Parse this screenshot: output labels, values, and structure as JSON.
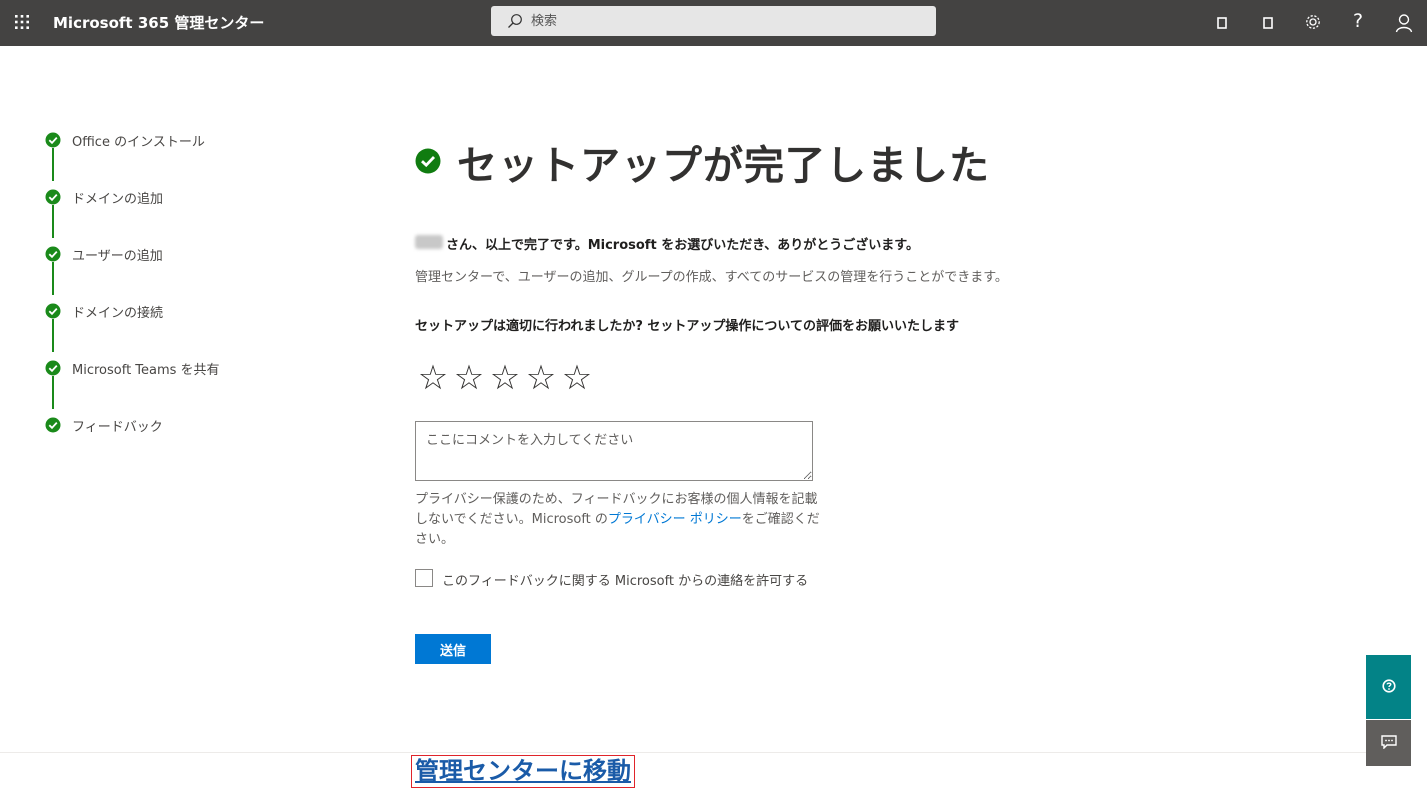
{
  "header": {
    "app_title": "Microsoft 365 管理センター",
    "search_placeholder": "検索",
    "help_glyph": "?",
    "bg_color": "#444342"
  },
  "stepper": {
    "items": [
      {
        "label": "Office のインストール",
        "status": "complete"
      },
      {
        "label": "ドメインの追加",
        "status": "complete"
      },
      {
        "label": "ユーザーの追加",
        "status": "complete"
      },
      {
        "label": "ドメインの接続",
        "status": "complete"
      },
      {
        "label": "Microsoft Teams を共有",
        "status": "complete"
      },
      {
        "label": "フィードバック",
        "status": "complete"
      }
    ],
    "check_color": "#1a8a1a"
  },
  "main": {
    "title": "セットアップが完了しました",
    "thanks": "さん、以上で完了です。Microsoft をお選びいただき、ありがとうございます。",
    "description": "管理センターで、ユーザーの追加、グループの作成、すべてのサービスの管理を行うことができます。",
    "rating_question": "セットアップは適切に行われましたか? セットアップ操作についての評価をお願いいたします",
    "rating": {
      "value": 0,
      "max": 5,
      "star_glyph": "☆"
    },
    "comment_placeholder": "ここにコメントを入力してください",
    "privacy_text_1": "プライバシー保護のため、フィードバックにお客様の個人情報を記載しないでください。Microsoft の",
    "privacy_link": "プライバシー ポリシー",
    "privacy_text_2": "をご確認ください。",
    "contact_checkbox_label": "このフィードバックに関する Microsoft からの連絡を許可する",
    "contact_checked": false,
    "submit_label": "送信",
    "goto_admin_link": "管理センターに移動"
  },
  "colors": {
    "accent": "#0078d4",
    "help_fab": "#038387",
    "feedback_fab": "#605e5c",
    "highlight_border": "#e0242a"
  }
}
